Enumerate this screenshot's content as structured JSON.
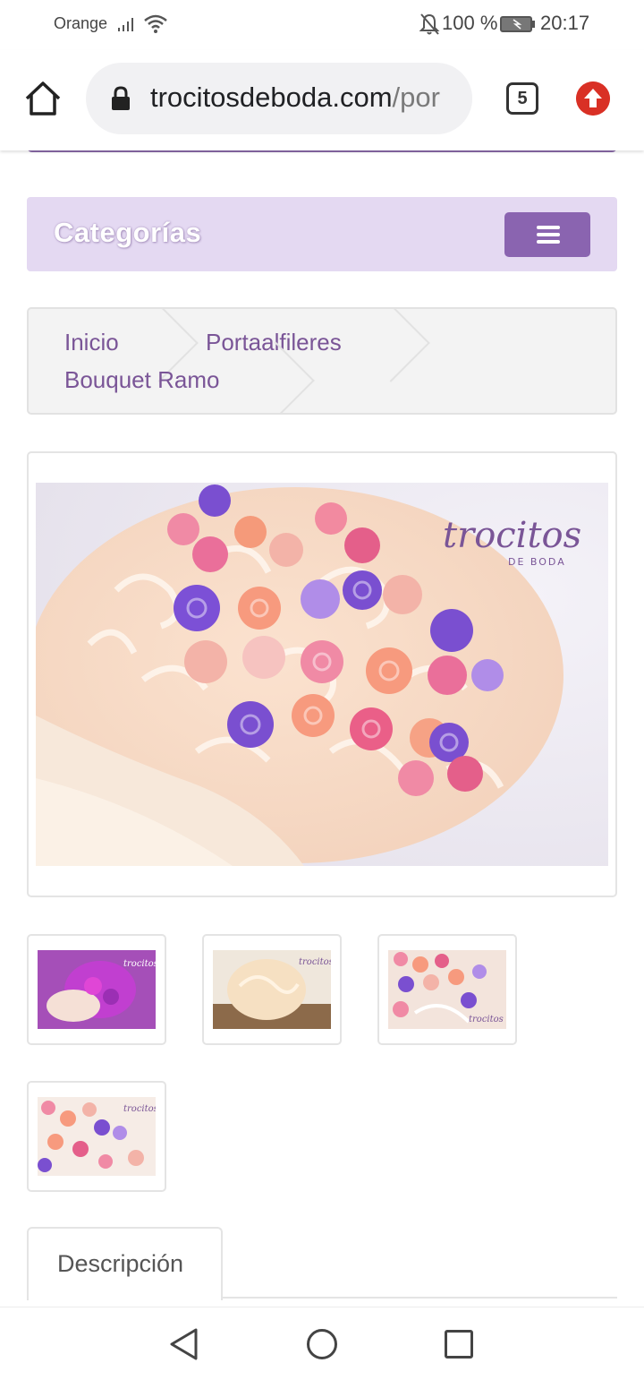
{
  "status_bar": {
    "carrier": "Orange",
    "battery": "100 %",
    "time": "20:17",
    "icons": [
      "signal-icon",
      "wifi-icon",
      "mute-icon",
      "battery-icon"
    ]
  },
  "browser": {
    "url_domain": "trocitosdeboda.com",
    "url_path": "/por",
    "tab_count": "5",
    "icons": [
      "home-icon",
      "lock-icon",
      "tabs-icon",
      "update-icon"
    ]
  },
  "categories": {
    "title": "Categorías",
    "menu_icon": "hamburger-icon"
  },
  "breadcrumb": {
    "items": [
      "Inicio",
      "Portaalfileres",
      "Bouquet Ramo"
    ]
  },
  "product": {
    "watermark": "trocitos",
    "watermark_sub": "DE BODA",
    "thumbnails": [
      "Thumbnail 1",
      "Thumbnail 2",
      "Thumbnail 3",
      "Thumbnail 4"
    ]
  },
  "tabs": {
    "description_label": "Descripción"
  },
  "nav_bar": {
    "icons": [
      "back-icon",
      "home-circle-icon",
      "recent-apps-icon"
    ]
  },
  "colors": {
    "accent": "#8a64b0",
    "category_bg": "#e4d9f2",
    "breadcrumb_text": "#7a5597",
    "update_red": "#d93025"
  }
}
